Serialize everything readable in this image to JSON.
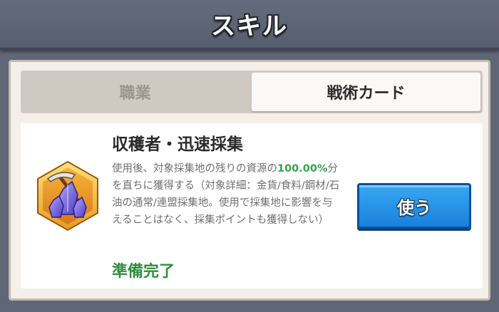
{
  "header": {
    "title": "スキル"
  },
  "tabs": [
    {
      "label": "職業",
      "active": false
    },
    {
      "label": "戦術カード",
      "active": true
    }
  ],
  "card": {
    "icon": "crystal-pickaxe-icon",
    "title": "収穫者・迅速採集",
    "desc_prefix": "使用後、対象採集地の残りの資源の",
    "desc_percent": "100.00%",
    "desc_suffix": "分を直ちに獲得する（対象詳細：金貨/食料/鋼材/石油の通常/連盟採集地。使用で採集地に影響を与えることはなく、採集ポイントも獲得しない）",
    "status": "準備完了",
    "button_label": "使う"
  },
  "colors": {
    "percent": "#3aa052",
    "status": "#2e8f3c",
    "button": "#1a80dc"
  }
}
